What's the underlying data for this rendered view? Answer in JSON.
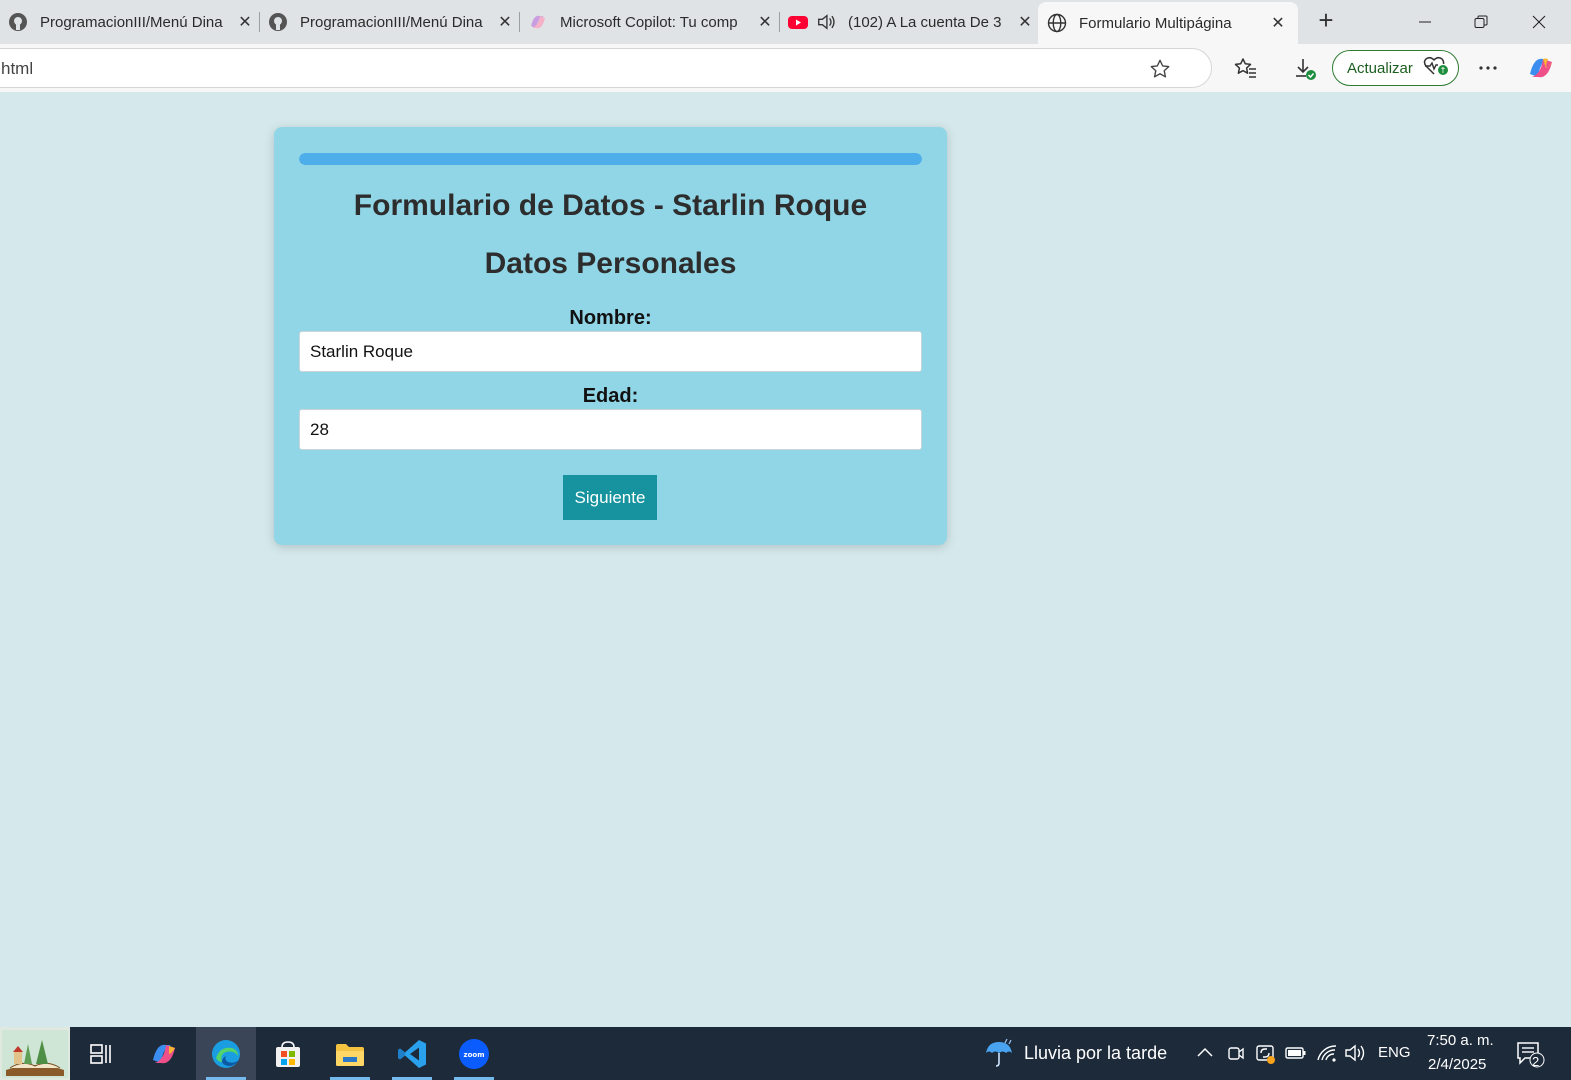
{
  "browser": {
    "tabs": [
      {
        "title": "ProgramacionIII/Menú Dina",
        "icon": "github-icon",
        "active": false
      },
      {
        "title": "ProgramacionIII/Menú Dina",
        "icon": "github-icon",
        "active": false
      },
      {
        "title": "Microsoft Copilot: Tu comp",
        "icon": "copilot-icon",
        "active": false
      },
      {
        "title": "(102) A La cuenta De 3",
        "icon": "youtube-icon",
        "active": false,
        "audio": true
      },
      {
        "title": "Formulario Multipágina",
        "icon": "globe-icon",
        "active": true
      }
    ],
    "address": "html",
    "update_label": "Actualizar"
  },
  "page": {
    "title": "Formulario de Datos - Starlin Roque",
    "section_title": "Datos Personales",
    "progress_fraction": 1.0,
    "fields": {
      "nombre_label": "Nombre:",
      "nombre_value": "Starlin Roque",
      "edad_label": "Edad:",
      "edad_value": "28"
    },
    "next_label": "Siguiente"
  },
  "taskbar": {
    "weather": "Lluvia por la tarde",
    "language": "ENG",
    "time": "7:50 a. m.",
    "date": "2/4/2025",
    "notification_count": "2"
  },
  "colors": {
    "page_bg": "#d5e9ec",
    "card_bg": "#91d6e6",
    "progress": "#4eaeea",
    "button": "#17939f"
  }
}
